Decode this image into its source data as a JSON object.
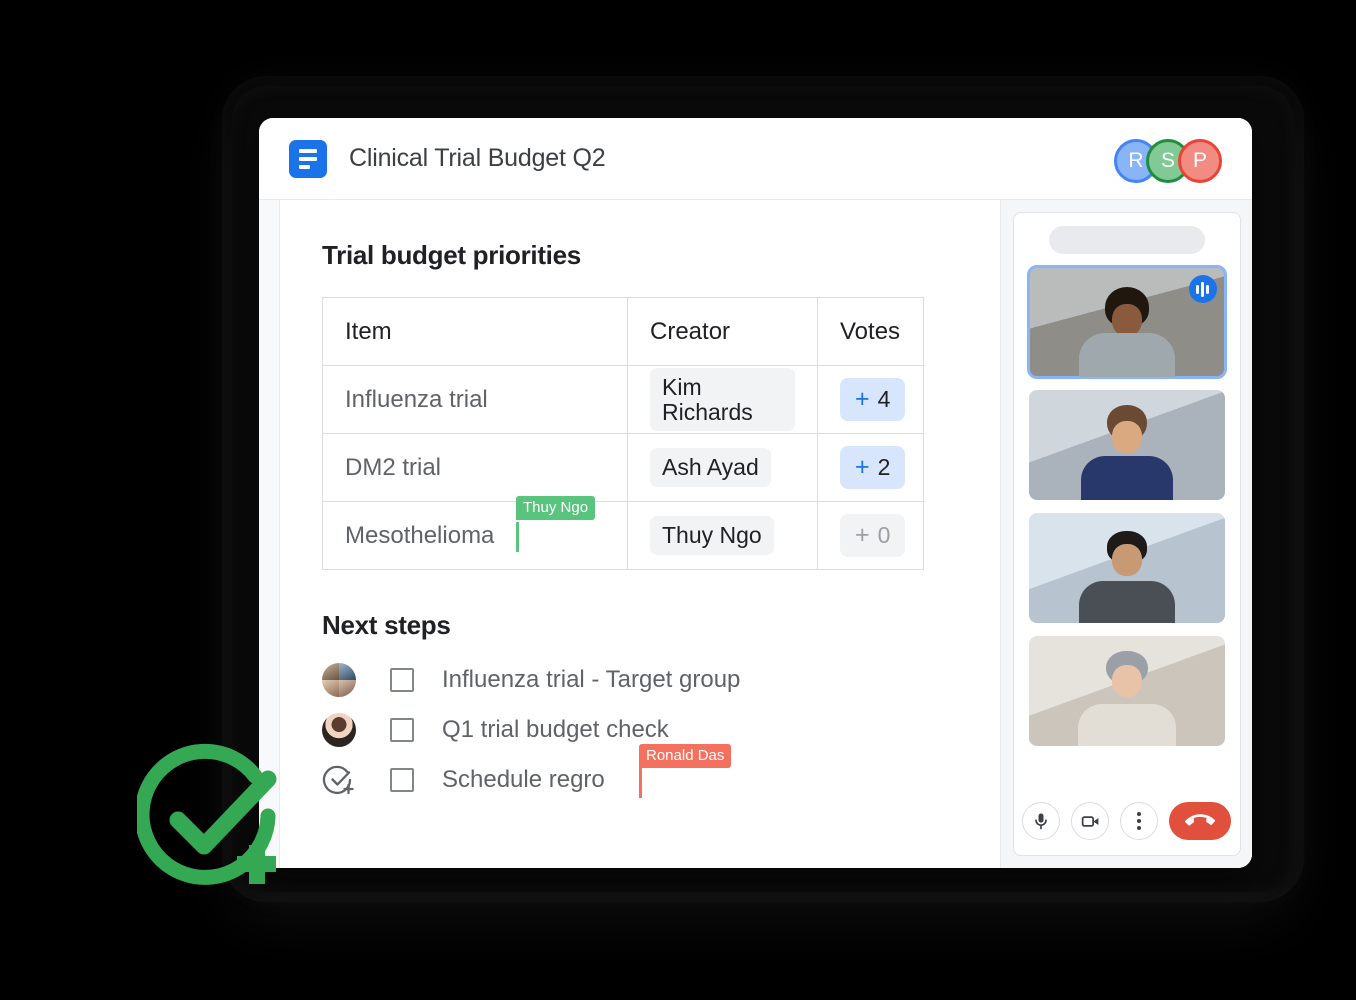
{
  "titlebar": {
    "doc_icon": "google-docs-icon",
    "title": "Clinical Trial Budget Q2",
    "avatars": [
      {
        "letter": "R",
        "name": "collaborator-r"
      },
      {
        "letter": "S",
        "name": "collaborator-s"
      },
      {
        "letter": "P",
        "name": "collaborator-p"
      }
    ]
  },
  "document": {
    "heading_table": "Trial budget priorities",
    "table": {
      "columns": [
        "Item",
        "Creator",
        "Votes"
      ],
      "rows": [
        {
          "item": "Influenza trial",
          "creator": "Kim Richards",
          "vote_plus": "+",
          "votes": "4",
          "zero": false
        },
        {
          "item": "DM2 trial",
          "creator": "Ash Ayad",
          "vote_plus": "+",
          "votes": "2",
          "zero": false
        },
        {
          "item": "Mesothelioma",
          "creator": "Thuy Ngo",
          "vote_plus": "+",
          "votes": "0",
          "zero": true
        }
      ]
    },
    "heading_next": "Next steps",
    "steps": [
      {
        "label": "Influenza trial - Target group",
        "avatar": "group-avatar"
      },
      {
        "label": "Q1 trial budget check",
        "avatar": "person-avatar"
      },
      {
        "label": "Schedule regro",
        "avatar": "assign-task-icon"
      }
    ],
    "cursors": [
      {
        "name": "Thuy Ngo",
        "color": "#58c47d"
      },
      {
        "name": "Ronald Das",
        "color": "#f4705f"
      }
    ]
  },
  "video_panel": {
    "placeholder": "",
    "tiles": [
      {
        "name": "participant-tile-1",
        "speaking": true,
        "badge": "audio-indicator-icon"
      },
      {
        "name": "participant-tile-2",
        "speaking": false
      },
      {
        "name": "participant-tile-3",
        "speaking": false
      },
      {
        "name": "participant-tile-4",
        "speaking": false
      }
    ],
    "controls": [
      {
        "name": "microphone-button",
        "icon": "microphone-icon"
      },
      {
        "name": "camera-button",
        "icon": "video-camera-icon"
      },
      {
        "name": "more-options-button",
        "icon": "three-dots-icon"
      },
      {
        "name": "end-call-button",
        "icon": "phone-hangup-icon"
      }
    ]
  },
  "branding": {
    "logo": "green-task-check-plus-icon",
    "color": "#34a853"
  },
  "colors": {
    "accent_blue": "#1a73e8",
    "vote_chip_bg": "#d7e6fd",
    "chip_bg": "#f1f3f4",
    "cursor_green": "#58c47d",
    "cursor_red": "#f4705f",
    "end_call_red": "#e0503c",
    "logo_green": "#34a853"
  }
}
